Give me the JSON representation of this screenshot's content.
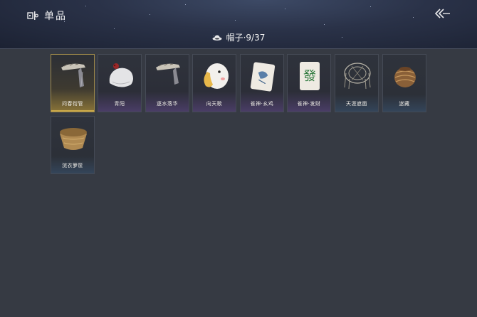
{
  "header": {
    "title": "单品",
    "category": "帽子·9/37"
  },
  "items": [
    {
      "label": "问春衔管",
      "icon": "jade-hairpin-icon",
      "style": "sel"
    },
    {
      "label": "青阳",
      "icon": "white-hat-icon",
      "style": "purple"
    },
    {
      "label": "逐水落华",
      "icon": "jade-hairpin-icon",
      "style": "purple"
    },
    {
      "label": "向天歌",
      "icon": "duck-hat-icon",
      "style": "purple"
    },
    {
      "label": "雀神·幺鸡",
      "icon": "mahjong-tile-bird-icon",
      "style": "purple"
    },
    {
      "label": "雀神·发财",
      "icon": "mahjong-tile-fa-icon",
      "style": "purple"
    },
    {
      "label": "天涯遮面",
      "icon": "bamboo-veil-hat-icon",
      "style": "blue"
    },
    {
      "label": "迷藏",
      "icon": "woven-ball-icon",
      "style": "blue"
    },
    {
      "label": "浣衣箩筐",
      "icon": "basket-hat-icon",
      "style": "blue"
    }
  ],
  "mahjong_glyph": "發",
  "colors": {
    "accent_gold": "#a08a4a",
    "accent_purple": "#6a5a9a",
    "accent_blue": "#4a6a8a"
  }
}
